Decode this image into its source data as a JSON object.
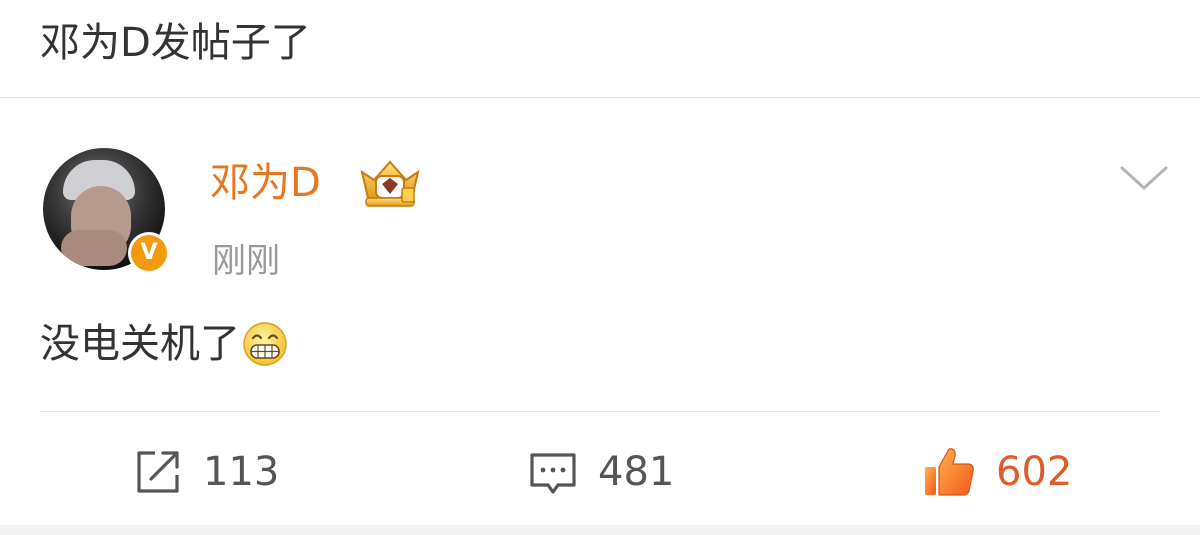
{
  "header": {
    "title": "邓为D发帖子了"
  },
  "post": {
    "author": {
      "name": "邓为D",
      "verified_badge": "V",
      "avatar_icon": "user-avatar",
      "crown_icon": "crown-badge-icon"
    },
    "timestamp": "刚刚",
    "text": "没电关机了",
    "emoji_icon": "grinning-face-emoji",
    "menu_icon": "chevron-down-icon"
  },
  "actions": {
    "repost": {
      "icon": "share-icon",
      "count": "113"
    },
    "comment": {
      "icon": "comment-icon",
      "count": "481"
    },
    "like": {
      "icon": "thumbs-up-icon",
      "count": "602"
    }
  },
  "colors": {
    "username": "#e8761e",
    "like_count": "#e05b25",
    "badge": "#f29a0e",
    "text": "#333333",
    "muted": "#999999"
  }
}
